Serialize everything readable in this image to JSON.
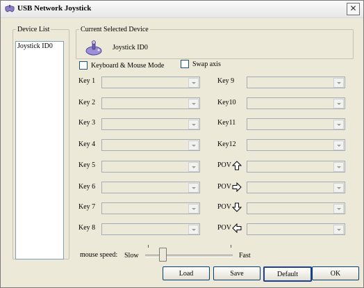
{
  "window": {
    "title": "USB Network Joystick"
  },
  "device_list": {
    "legend": "Device List",
    "items": [
      "Joystick ID0"
    ]
  },
  "current_device": {
    "legend": "Current Selected Device",
    "name": "Joystick ID0"
  },
  "options": {
    "keyboard_mouse_mode": "Keyboard & Mouse Mode",
    "swap_axis": "Swap axis"
  },
  "keys_left": [
    "Key 1",
    "Key 2",
    "Key 3",
    "Key 4",
    "Key 5",
    "Key 6",
    "Key 7",
    "Key 8"
  ],
  "keys_right": [
    "Key 9",
    "Key10",
    "Key11",
    "Key12",
    "POV",
    "POV",
    "POV",
    "POV"
  ],
  "pov_directions": [
    "arrow-up-icon",
    "arrow-right-icon",
    "arrow-down-icon",
    "arrow-left-icon"
  ],
  "mouse_speed": {
    "label": "mouse speed:",
    "slow": "Slow",
    "fast": "Fast"
  },
  "buttons": {
    "load": "Load",
    "save": "Save",
    "default": "Default",
    "ok": "OK"
  }
}
